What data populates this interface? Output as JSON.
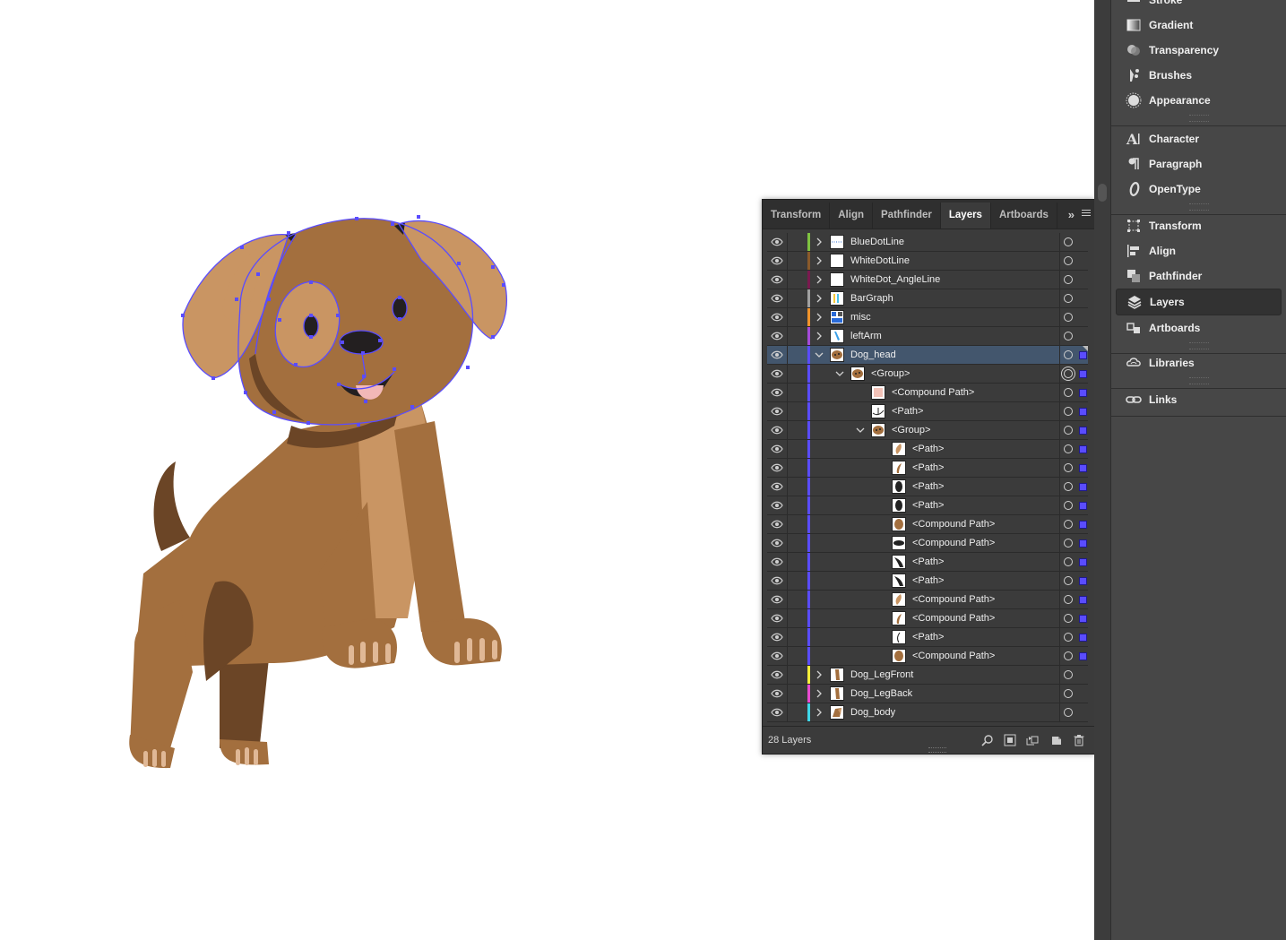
{
  "panel": {
    "tabs": [
      {
        "label": "Transform"
      },
      {
        "label": "Align"
      },
      {
        "label": "Pathfinder"
      },
      {
        "label": "Layers",
        "active": true
      },
      {
        "label": "Artboards"
      }
    ],
    "more_glyph": "»",
    "layer_count": "28 Layers",
    "rows": [
      {
        "name": "BlueDotLine",
        "color": "#7fc241",
        "indent": 0,
        "expand": "right",
        "thumb": "dots",
        "selected": false
      },
      {
        "name": "WhiteDotLine",
        "color": "#8a5a2b",
        "indent": 0,
        "expand": "right",
        "thumb": "blank",
        "selected": false
      },
      {
        "name": "WhiteDot_AngleLine",
        "color": "#7a1a4f",
        "indent": 0,
        "expand": "right",
        "thumb": "blank",
        "selected": false
      },
      {
        "name": "BarGraph",
        "color": "#a0a0a0",
        "indent": 0,
        "expand": "right",
        "thumb": "bars",
        "selected": false
      },
      {
        "name": "misc",
        "color": "#f0932b",
        "indent": 0,
        "expand": "right",
        "thumb": "misc",
        "selected": false
      },
      {
        "name": "leftArm",
        "color": "#a44ad8",
        "indent": 0,
        "expand": "right",
        "thumb": "arm",
        "selected": false
      },
      {
        "name": "Dog_head",
        "color": "#5a4cff",
        "indent": 0,
        "expand": "down",
        "thumb": "head",
        "selected": true
      },
      {
        "name": "<Group>",
        "color": "#5a4cff",
        "indent": 1,
        "expand": "down",
        "thumb": "head",
        "selected": false
      },
      {
        "name": "<Compound Path>",
        "color": "#5a4cff",
        "indent": 2,
        "expand": "none",
        "thumb": "pink",
        "selected": false
      },
      {
        "name": "<Path>",
        "color": "#5a4cff",
        "indent": 2,
        "expand": "none",
        "thumb": "mouth",
        "selected": false
      },
      {
        "name": "<Group>",
        "color": "#5a4cff",
        "indent": 2,
        "expand": "down",
        "thumb": "head",
        "selected": false
      },
      {
        "name": "<Path>",
        "color": "#5a4cff",
        "indent": 3,
        "expand": "none",
        "thumb": "ear",
        "selected": false
      },
      {
        "name": "<Path>",
        "color": "#5a4cff",
        "indent": 3,
        "expand": "none",
        "thumb": "ear2",
        "selected": false
      },
      {
        "name": "<Path>",
        "color": "#5a4cff",
        "indent": 3,
        "expand": "none",
        "thumb": "blackeye",
        "selected": false
      },
      {
        "name": "<Path>",
        "color": "#5a4cff",
        "indent": 3,
        "expand": "none",
        "thumb": "blackeye",
        "selected": false
      },
      {
        "name": "<Compound Path>",
        "color": "#5a4cff",
        "indent": 3,
        "expand": "none",
        "thumb": "brownoval",
        "selected": false
      },
      {
        "name": "<Compound Path>",
        "color": "#5a4cff",
        "indent": 3,
        "expand": "none",
        "thumb": "nose",
        "selected": false
      },
      {
        "name": "<Path>",
        "color": "#5a4cff",
        "indent": 3,
        "expand": "none",
        "thumb": "blackcurve",
        "selected": false
      },
      {
        "name": "<Path>",
        "color": "#5a4cff",
        "indent": 3,
        "expand": "none",
        "thumb": "blackcurve",
        "selected": false
      },
      {
        "name": "<Compound Path>",
        "color": "#5a4cff",
        "indent": 3,
        "expand": "none",
        "thumb": "ear",
        "selected": false
      },
      {
        "name": "<Compound Path>",
        "color": "#5a4cff",
        "indent": 3,
        "expand": "none",
        "thumb": "ear2",
        "selected": false
      },
      {
        "name": "<Path>",
        "color": "#5a4cff",
        "indent": 3,
        "expand": "none",
        "thumb": "line",
        "selected": false
      },
      {
        "name": "<Compound Path>",
        "color": "#5a4cff",
        "indent": 3,
        "expand": "none",
        "thumb": "brownoval",
        "selected": false
      },
      {
        "name": "Dog_LegFront",
        "color": "#f6ee3a",
        "indent": 0,
        "expand": "right",
        "thumb": "leg",
        "selected": false
      },
      {
        "name": "Dog_LegBack",
        "color": "#e94bd0",
        "indent": 0,
        "expand": "right",
        "thumb": "leg",
        "selected": false
      },
      {
        "name": "Dog_body",
        "color": "#3fd6e8",
        "indent": 0,
        "expand": "right",
        "thumb": "body",
        "selected": false
      }
    ],
    "footer_icons": [
      "locate-object-icon",
      "make-clipping-mask-icon",
      "collect-in-new-layer-icon",
      "create-new-layer-icon",
      "trash-icon"
    ]
  },
  "dock": {
    "groups": [
      {
        "items": [
          {
            "label": "Stroke",
            "icon": "stroke-icon"
          },
          {
            "label": "Gradient",
            "icon": "gradient-icon"
          },
          {
            "label": "Transparency",
            "icon": "transparency-icon"
          },
          {
            "label": "Brushes",
            "icon": "brushes-icon"
          },
          {
            "label": "Appearance",
            "icon": "appearance-icon"
          }
        ]
      },
      {
        "items": [
          {
            "label": "Character",
            "icon": "character-icon"
          },
          {
            "label": "Paragraph",
            "icon": "paragraph-icon"
          },
          {
            "label": "OpenType",
            "icon": "opentype-icon"
          }
        ]
      },
      {
        "items": [
          {
            "label": "Transform",
            "icon": "transform-icon"
          },
          {
            "label": "Align",
            "icon": "align-icon"
          },
          {
            "label": "Pathfinder",
            "icon": "pathfinder-icon"
          },
          {
            "label": "Layers",
            "icon": "layers-icon",
            "active": true
          },
          {
            "label": "Artboards",
            "icon": "artboards-icon"
          }
        ]
      },
      {
        "items": [
          {
            "label": "Libraries",
            "icon": "libraries-icon"
          }
        ]
      },
      {
        "items": [
          {
            "label": "Links",
            "icon": "links-icon"
          }
        ]
      }
    ]
  },
  "colors": {
    "selection": "#5a4cff",
    "dog_mid": "#a36f3e",
    "dog_light": "#c99563",
    "dog_dark": "#6b4526",
    "dog_toe": "#e0b896",
    "tongue": "#f2b8b8",
    "eye": "#231f20",
    "panel_bg": "#3b3b3b",
    "dock_bg": "#474747",
    "selected_row": "#43566d"
  }
}
